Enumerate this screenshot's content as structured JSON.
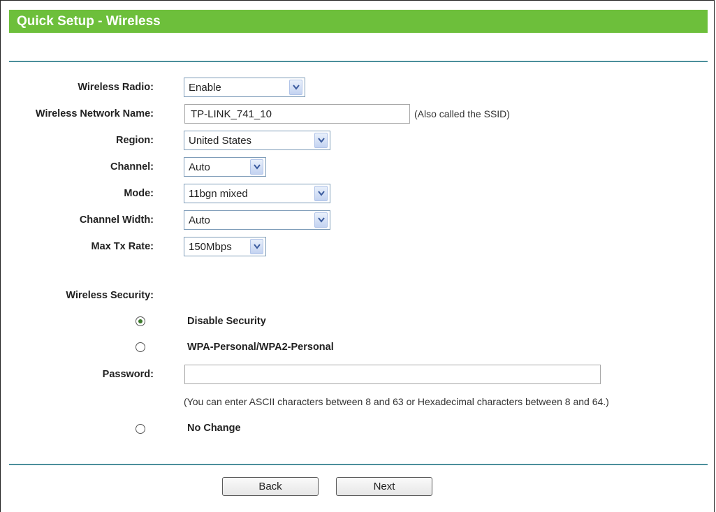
{
  "header": {
    "title": "Quick Setup - Wireless"
  },
  "form": {
    "wireless_radio": {
      "label": "Wireless Radio:",
      "value": "Enable"
    },
    "network_name": {
      "label": "Wireless Network Name:",
      "value": "TP-LINK_741_10",
      "hint": "(Also called the SSID)"
    },
    "region": {
      "label": "Region:",
      "value": "United States"
    },
    "channel": {
      "label": "Channel:",
      "value": "Auto"
    },
    "mode": {
      "label": "Mode:",
      "value": "11bgn mixed"
    },
    "channel_width": {
      "label": "Channel Width:",
      "value": "Auto"
    },
    "max_tx_rate": {
      "label": "Max Tx Rate:",
      "value": "150Mbps"
    }
  },
  "security": {
    "label": "Wireless Security:",
    "options": [
      {
        "label": "Disable Security",
        "checked": true
      },
      {
        "label": "WPA-Personal/WPA2-Personal",
        "checked": false
      },
      {
        "label": "No Change",
        "checked": false
      }
    ],
    "password": {
      "label": "Password:",
      "value": "",
      "hint": "(You can enter ASCII characters between 8 and 63 or Hexadecimal characters between 8 and 64.)"
    }
  },
  "buttons": {
    "back": "Back",
    "next": "Next"
  },
  "colors": {
    "header": "#6dbf3b",
    "divider": "#4b8f9b"
  }
}
